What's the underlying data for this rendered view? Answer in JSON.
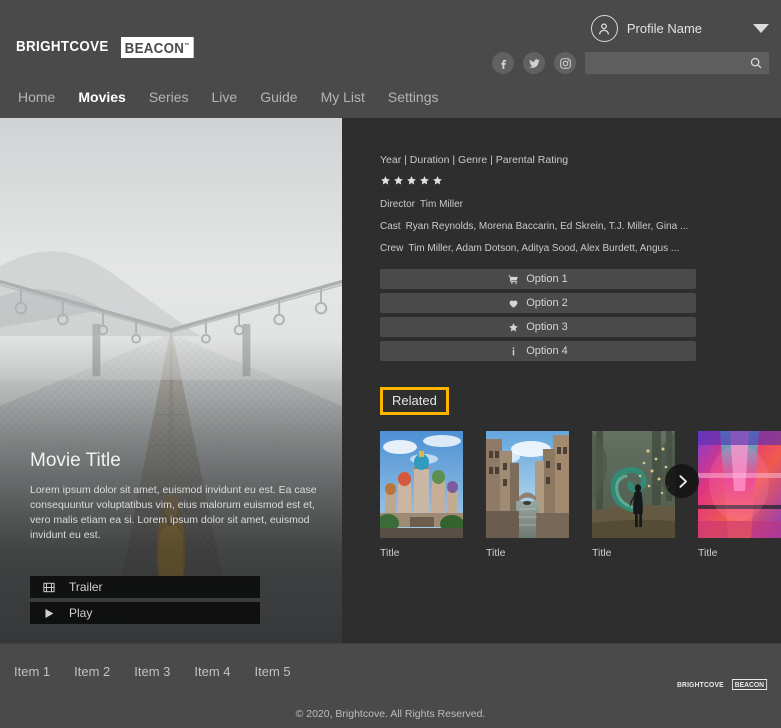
{
  "brand": {
    "word": "BRIGHTCOVE",
    "badge": "BEACON",
    "tm": "™"
  },
  "header": {
    "profile_name": "Profile Name",
    "profile_avatar_icon": "user-avatar-icon",
    "chevron_icon": "chevron-down-icon",
    "social": [
      {
        "name": "facebook-icon",
        "glyph": "f"
      },
      {
        "name": "twitter-icon",
        "glyph": "t"
      },
      {
        "name": "instagram-icon",
        "glyph": "i"
      }
    ],
    "search": {
      "value": "",
      "placeholder": "",
      "icon": "search-icon"
    },
    "nav": [
      {
        "label": "Home",
        "active": false
      },
      {
        "label": "Movies",
        "active": true
      },
      {
        "label": "Series",
        "active": false
      },
      {
        "label": "Live",
        "active": false
      },
      {
        "label": "Guide",
        "active": false
      },
      {
        "label": "My List",
        "active": false
      },
      {
        "label": "Settings",
        "active": false
      }
    ]
  },
  "hero": {
    "title": "Movie Title",
    "description": "Lorem ipsum dolor sit amet, euismod invidunt eu est. Ea case consequuntur voluptatibus vim, eius malorum euismod est et, vero malis etiam ea si. Lorem ipsum dolor sit amet, euismod invidunt eu est.",
    "buttons": [
      {
        "label": "Trailer",
        "icon": "film-strip-icon"
      },
      {
        "label": "Play",
        "icon": "play-icon"
      }
    ],
    "image_alt": "foggy-suspension-bridge"
  },
  "detail": {
    "meta_line": "Year | Duration | Genre | Parental Rating",
    "rating_stars": 5,
    "credits": [
      {
        "key": "Director",
        "value": "Tim Miller"
      },
      {
        "key": "Cast",
        "value": "Ryan Reynolds, Morena Baccarin, Ed Skrein, T.J. Miller, Gina ..."
      },
      {
        "key": "Crew",
        "value": "Tim Miller, Adam Dotson, Aditya Sood, Alex Burdett, Angus ..."
      }
    ],
    "options": [
      {
        "label": "Option 1",
        "icon": "shopping-cart-icon"
      },
      {
        "label": "Option 2",
        "icon": "heart-icon"
      },
      {
        "label": "Option 3",
        "icon": "star-icon"
      },
      {
        "label": "Option 4",
        "icon": "info-icon"
      }
    ],
    "related": {
      "label": "Related",
      "highlight_color": "#ffb400",
      "next_icon": "chevron-right-icon",
      "items": [
        {
          "title": "Title",
          "image_alt": "saint-basils-cathedral"
        },
        {
          "title": "Title",
          "image_alt": "venice-canal"
        },
        {
          "title": "Title",
          "image_alt": "woman-green-smoke-forest"
        },
        {
          "title": "Title",
          "image_alt": "neon-abstract-lights"
        }
      ]
    }
  },
  "footer": {
    "links": [
      "Item 1",
      "Item 2",
      "Item 3",
      "Item 4",
      "Item 5"
    ],
    "copyright": "© 2020, Brightcove. All Rights Reserved."
  }
}
